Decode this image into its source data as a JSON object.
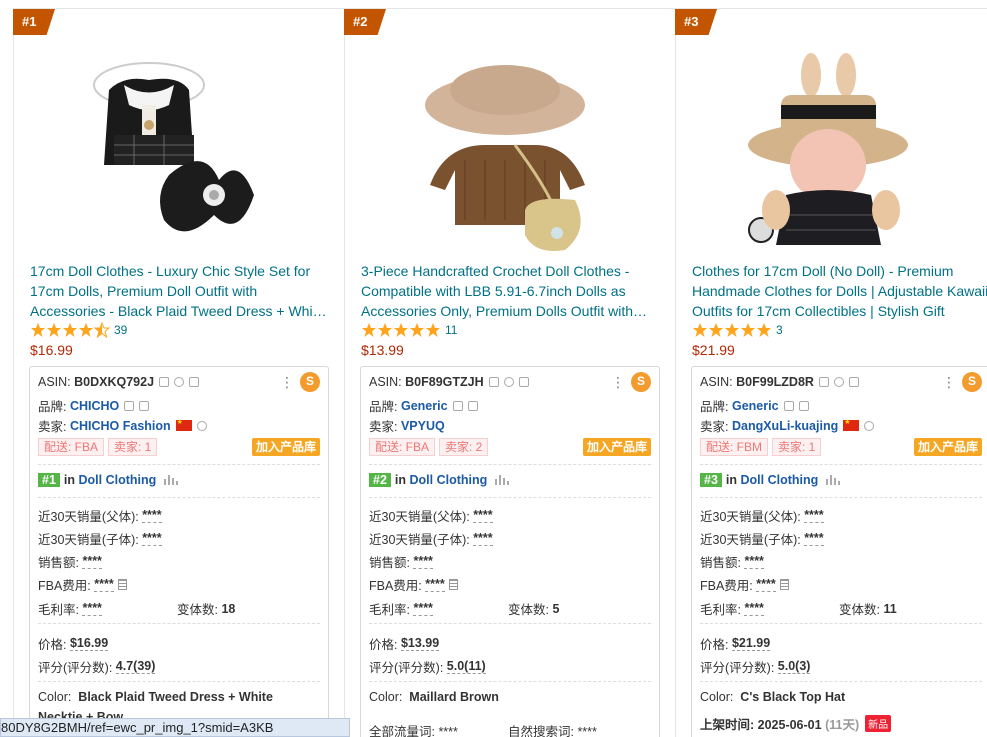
{
  "products": [
    {
      "rank_tag": "#1",
      "title": "17cm Doll Clothes - Luxury Chic Style Set for 17cm Dolls, Premium Doll Outfit with Accessories - Black Plaid Tweed Dress + White Necktie + Bow",
      "rating_value": 4.5,
      "rating_count": "39",
      "price": "$16.99",
      "asin_label": "ASIN:",
      "asin": "B0DXKQ792J",
      "brand_label": "品牌:",
      "brand": "CHICHO",
      "seller_label": "卖家:",
      "seller": "CHICHO Fashion",
      "ship_tag": "配送: FBA",
      "seller_count_tag": "卖家: 1",
      "add_lib": "加入产品库",
      "rank_badge": "#1",
      "rank_in": "in",
      "category": "Doll Clothing",
      "sales30_parent_label": "近30天销量(父体):",
      "sales30_parent": "****",
      "sales30_child_label": "近30天销量(子体):",
      "sales30_child": "****",
      "revenue_label": "销售额:",
      "revenue": "****",
      "fba_label": "FBA费用:",
      "fba": "****",
      "margin_label": "毛利率:",
      "margin": "****",
      "variants_label": "变体数:",
      "variants": "18",
      "price_label": "价格:",
      "price_val": "$16.99",
      "score_label": "评分(评分数):",
      "score": "4.7(39)",
      "extra1_label": "Color:",
      "extra1_val": "Black Plaid Tweed Dress + White",
      "extra2_text": "Necktie + Bow",
      "extra2_val": ""
    },
    {
      "rank_tag": "#2",
      "title": "3-Piece Handcrafted Crochet Doll Clothes - Compatible with LBB 5.91-6.7inch Dolls as Accessories Only, Premium Dolls Outfit with Bag",
      "rating_value": 5,
      "rating_count": "11",
      "price": "$13.99",
      "asin_label": "ASIN:",
      "asin": "B0F89GTZJH",
      "brand_label": "品牌:",
      "brand": "Generic",
      "seller_label": "卖家:",
      "seller": "VPYUQ",
      "ship_tag": "配送: FBA",
      "seller_count_tag": "卖家: 2",
      "add_lib": "加入产品库",
      "rank_badge": "#2",
      "rank_in": "in",
      "category": "Doll Clothing",
      "sales30_parent_label": "近30天销量(父体):",
      "sales30_parent": "****",
      "sales30_child_label": "近30天销量(子体):",
      "sales30_child": "****",
      "revenue_label": "销售额:",
      "revenue": "****",
      "fba_label": "FBA费用:",
      "fba": "****",
      "margin_label": "毛利率:",
      "margin": "****",
      "variants_label": "变体数:",
      "variants": "5",
      "price_label": "价格:",
      "price_val": "$13.99",
      "score_label": "评分(评分数):",
      "score": "5.0(11)",
      "extra1_label": "Color:",
      "extra1_val": "Maillard Brown",
      "extra2_text": "全部流量词: ****",
      "extra2_val": "自然搜索词: ****"
    },
    {
      "rank_tag": "#3",
      "title": "Clothes for 17cm Doll (No Doll) - Premium Handmade Clothes for Dolls | Adjustable Kawaii Outfits for 17cm Collectibles | Stylish Gift",
      "rating_value": 5,
      "rating_count": "3",
      "price": "$21.99",
      "asin_label": "ASIN:",
      "asin": "B0F99LZD8R",
      "brand_label": "品牌:",
      "brand": "Generic",
      "seller_label": "卖家:",
      "seller": "DangXuLi-kuajing",
      "ship_tag": "配送: FBM",
      "seller_count_tag": "卖家: 1",
      "add_lib": "加入产品库",
      "rank_badge": "#3",
      "rank_in": "in",
      "category": "Doll Clothing",
      "sales30_parent_label": "近30天销量(父体):",
      "sales30_parent": "****",
      "sales30_child_label": "近30天销量(子体):",
      "sales30_child": "****",
      "revenue_label": "销售额:",
      "revenue": "****",
      "fba_label": "FBA费用:",
      "fba": "****",
      "margin_label": "毛利率:",
      "margin": "****",
      "variants_label": "变体数:",
      "variants": "11",
      "price_label": "价格:",
      "price_val": "$21.99",
      "score_label": "评分(评分数):",
      "score": "5.0(3)",
      "extra1_label": "Color:",
      "extra1_val": "C's Black Top Hat",
      "extra2_text": "上架时间: 2025-06-01",
      "extra2_val": "(11天)",
      "new_badge": "新品"
    }
  ],
  "status_url": "80DY8G2BMH/ref=ewc_pr_img_1?smid=A3KB",
  "colors": {
    "accent": "#c45500",
    "link": "#007185",
    "price": "#b12704",
    "star": "#ffa41c",
    "plugin": "#f39b2c"
  }
}
